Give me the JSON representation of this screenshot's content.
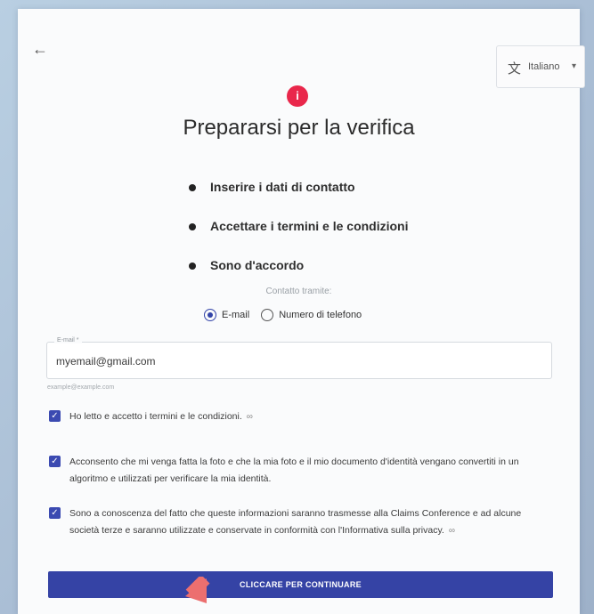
{
  "header": {
    "back_icon": "arrow-left-icon",
    "language_icon": "translate-icon",
    "language_label": "Italiano",
    "language_caret": "▾"
  },
  "page": {
    "info_icon": "i",
    "title": "Prepararsi per la verifica"
  },
  "steps": [
    "Inserire i dati di contatto",
    "Accettare i termini e le condizioni",
    "Sono d'accordo"
  ],
  "contact": {
    "label": "Contatto tramite:",
    "options": [
      {
        "label": "E-mail",
        "selected": true
      },
      {
        "label": "Numero di telefono",
        "selected": false
      }
    ]
  },
  "email": {
    "floating_label": "E-mail *",
    "value": "myemail@gmail.com",
    "hint": "example@example.com"
  },
  "checks": [
    {
      "text": "Ho letto e accetto i termini e le condizioni.",
      "checked": true
    },
    {
      "text": "Acconsento che mi venga fatta la foto e che la mia foto e il mio documento d'identità vengano convertiti in un algoritmo e utilizzati per verificare la mia identità.",
      "checked": true
    },
    {
      "text": "Sono a conoscenza del fatto che queste informazioni saranno trasmesse alla Claims Conference e ad alcune società terze e saranno utilizzate e conservate in conformità con l'Informativa sulla privacy.",
      "checked": true
    }
  ],
  "cta": {
    "label": "CLICCARE PER CONTINUARE"
  },
  "colors": {
    "accent": "#3543a5",
    "info": "#e9274b",
    "pointer_arrow": "#ec6f6f"
  }
}
